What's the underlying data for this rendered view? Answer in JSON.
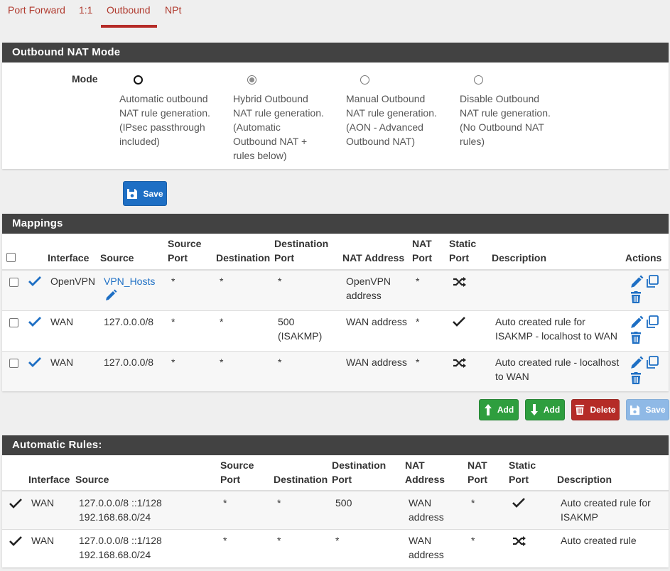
{
  "tabs": [
    {
      "label": "Port Forward"
    },
    {
      "label": "1:1"
    },
    {
      "label": "Outbound",
      "active": true
    },
    {
      "label": "NPt"
    }
  ],
  "nat_mode": {
    "title": "Outbound NAT Mode",
    "mode_label": "Mode",
    "selected": "hybrid",
    "options": [
      {
        "value": "automatic",
        "lines": [
          "Automatic outbound",
          "NAT rule generation.",
          "(IPsec passthrough",
          "included)"
        ]
      },
      {
        "value": "hybrid",
        "lines": [
          "Hybrid Outbound",
          "NAT rule generation.",
          "(Automatic",
          "Outbound NAT +",
          "rules below)"
        ]
      },
      {
        "value": "manual",
        "lines": [
          "Manual Outbound",
          "NAT rule generation.",
          "(AON - Advanced",
          "Outbound NAT)"
        ]
      },
      {
        "value": "disabled",
        "lines": [
          "Disable Outbound",
          "NAT rule generation.",
          "(No Outbound NAT",
          "rules)"
        ]
      }
    ],
    "save_label": "Save"
  },
  "mappings": {
    "title": "Mappings",
    "headers": {
      "interface": "Interface",
      "source": "Source",
      "source_port": [
        "Source",
        "Port"
      ],
      "destination": "Destination",
      "destination_port": [
        "Destination",
        "Port"
      ],
      "nat_address": "NAT Address",
      "nat_port": [
        "NAT",
        "Port"
      ],
      "static_port": [
        "Static",
        "Port"
      ],
      "description": "Description",
      "actions": "Actions"
    },
    "rows": [
      {
        "interface": "OpenVPN",
        "source": "VPN_Hosts",
        "source_port": "*",
        "destination": "*",
        "destination_port": [
          "*"
        ],
        "nat_address": [
          "OpenVPN",
          "address"
        ],
        "nat_port": "*",
        "static_port": "shuffle",
        "description": []
      },
      {
        "interface": "WAN",
        "source": "127.0.0.0/8",
        "source_port": "*",
        "destination": "*",
        "destination_port": [
          "500",
          "(ISAKMP)"
        ],
        "nat_address": [
          "WAN address"
        ],
        "nat_port": "*",
        "static_port": "check",
        "description": [
          "Auto created rule for",
          "ISAKMP - localhost to WAN"
        ]
      },
      {
        "interface": "WAN",
        "source": "127.0.0.0/8",
        "source_port": "*",
        "destination": "*",
        "destination_port": [
          "*"
        ],
        "nat_address": [
          "WAN address"
        ],
        "nat_port": "*",
        "static_port": "shuffle",
        "description": [
          "Auto created rule - localhost",
          "to WAN"
        ]
      }
    ],
    "buttons": {
      "add_top": "Add",
      "add_bottom": "Add",
      "delete": "Delete",
      "save": "Save"
    }
  },
  "automatic_rules": {
    "title": "Automatic Rules:",
    "headers": {
      "interface": "Interface",
      "source": "Source",
      "source_port": [
        "Source",
        "Port"
      ],
      "destination": "Destination",
      "destination_port": [
        "Destination",
        "Port"
      ],
      "nat_address": [
        "NAT",
        "Address"
      ],
      "nat_port": [
        "NAT",
        "Port"
      ],
      "static_port": [
        "Static",
        "Port"
      ],
      "description": "Description"
    },
    "rows": [
      {
        "interface": "WAN",
        "source": [
          "127.0.0.0/8 ::1/128",
          "192.168.68.0/24"
        ],
        "source_port": "*",
        "destination": "*",
        "destination_port": "500",
        "nat_address": [
          "WAN",
          "address"
        ],
        "nat_port": "*",
        "static_port": "check",
        "description": [
          "Auto created rule for",
          "ISAKMP"
        ]
      },
      {
        "interface": "WAN",
        "source": [
          "127.0.0.0/8 ::1/128",
          "192.168.68.0/24"
        ],
        "source_port": "*",
        "destination": "*",
        "destination_port": "*",
        "nat_address": [
          "WAN",
          "address"
        ],
        "nat_port": "*",
        "static_port": "shuffle",
        "description": [
          "Auto created rule"
        ]
      }
    ]
  },
  "colors": {
    "accent_red": "#b52b27",
    "primary_blue": "#1e6fc4",
    "success_green": "#2e9e3e",
    "header_dark": "#424242"
  }
}
